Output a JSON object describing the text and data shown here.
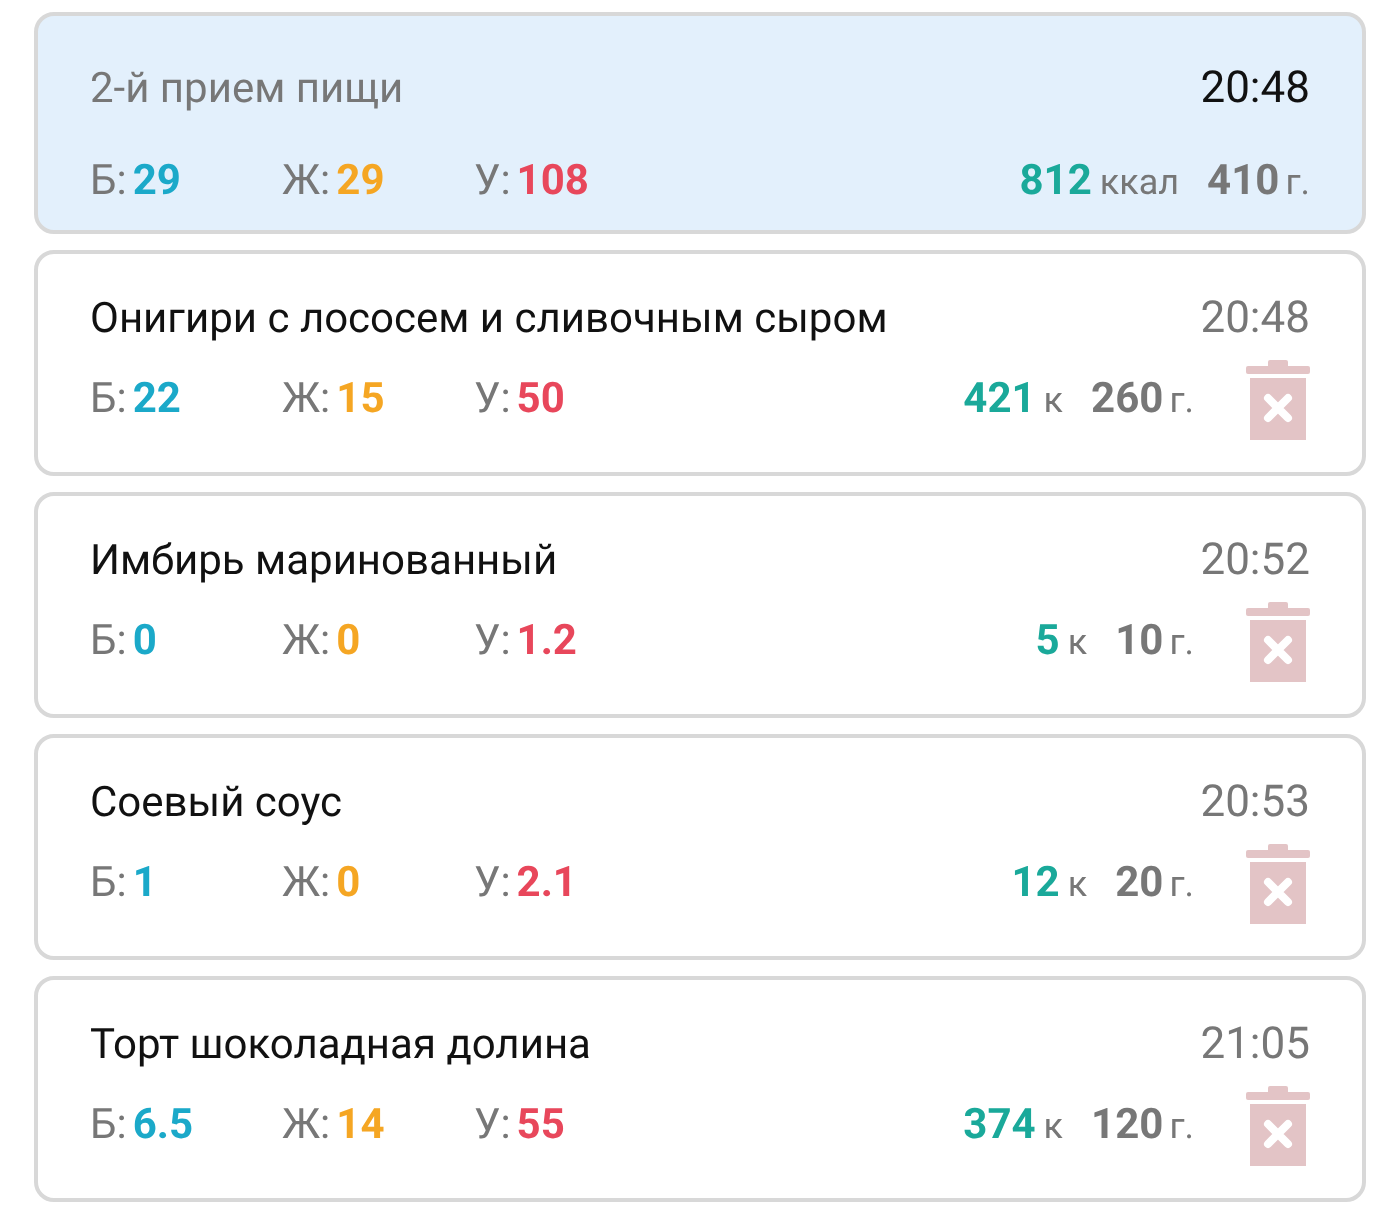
{
  "summary": {
    "title": "2-й прием пищи",
    "time": "20:48",
    "macros": [
      {
        "kind": "protein",
        "label": "Б:",
        "value": "29"
      },
      {
        "kind": "fat",
        "label": "Ж:",
        "value": "29"
      },
      {
        "kind": "carbs",
        "label": "У:",
        "value": "108"
      }
    ],
    "kcal": "812",
    "kcal_unit": "ккал",
    "weight": "410",
    "weight_unit": "г."
  },
  "items": [
    {
      "name": "Онигири с лососем и сливочным сыром",
      "time": "20:48",
      "macros": [
        {
          "kind": "protein",
          "label": "Б:",
          "value": "22"
        },
        {
          "kind": "fat",
          "label": "Ж:",
          "value": "15"
        },
        {
          "kind": "carbs",
          "label": "У:",
          "value": "50"
        }
      ],
      "kcal": "421",
      "kcal_unit": "к",
      "weight": "260",
      "weight_unit": "г."
    },
    {
      "name": "Имбирь маринованный",
      "time": "20:52",
      "macros": [
        {
          "kind": "protein",
          "label": "Б:",
          "value": "0"
        },
        {
          "kind": "fat",
          "label": "Ж:",
          "value": "0"
        },
        {
          "kind": "carbs",
          "label": "У:",
          "value": "1.2"
        }
      ],
      "kcal": "5",
      "kcal_unit": "к",
      "weight": "10",
      "weight_unit": "г."
    },
    {
      "name": "Соевый соус",
      "time": "20:53",
      "macros": [
        {
          "kind": "protein",
          "label": "Б:",
          "value": "1"
        },
        {
          "kind": "fat",
          "label": "Ж:",
          "value": "0"
        },
        {
          "kind": "carbs",
          "label": "У:",
          "value": "2.1"
        }
      ],
      "kcal": "12",
      "kcal_unit": "к",
      "weight": "20",
      "weight_unit": "г."
    },
    {
      "name": "Торт шоколадная долина",
      "time": "21:05",
      "macros": [
        {
          "kind": "protein",
          "label": "Б:",
          "value": "6.5"
        },
        {
          "kind": "fat",
          "label": "Ж:",
          "value": "14"
        },
        {
          "kind": "carbs",
          "label": "У:",
          "value": "55"
        }
      ],
      "kcal": "374",
      "kcal_unit": "к",
      "weight": "120",
      "weight_unit": "г."
    }
  ]
}
